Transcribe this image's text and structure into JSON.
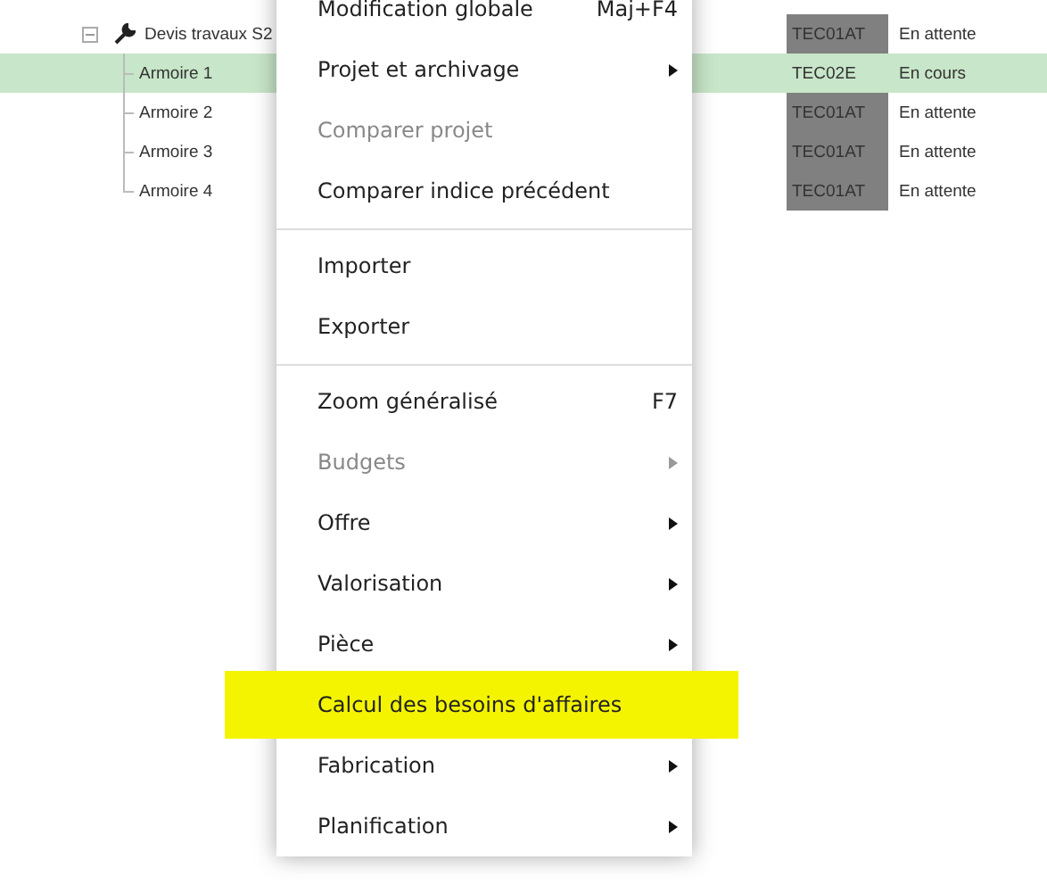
{
  "tree": [
    {
      "label": "Devis travaux S2",
      "expanded": true,
      "selected": false,
      "code": "TEC01AT",
      "status": "En attente",
      "children": [
        {
          "label": "Armoire 1",
          "selected": true,
          "code": "TEC02E",
          "status": "En cours"
        },
        {
          "label": "Armoire 2",
          "selected": false,
          "code": "TEC01AT",
          "status": "En attente"
        },
        {
          "label": "Armoire 3",
          "selected": false,
          "code": "TEC01AT",
          "status": "En attente"
        },
        {
          "label": "Armoire 4",
          "selected": false,
          "code": "TEC01AT",
          "status": "En attente"
        }
      ]
    }
  ],
  "context_menu": [
    {
      "kind": "item",
      "label": "Modification globale",
      "shortcut": "Maj+F4",
      "disabled": false,
      "submenu": false,
      "highlighted": false
    },
    {
      "kind": "item",
      "label": "Projet et archivage",
      "disabled": false,
      "submenu": true,
      "highlighted": false
    },
    {
      "kind": "item",
      "label": "Comparer projet",
      "disabled": true,
      "submenu": false,
      "highlighted": false
    },
    {
      "kind": "item",
      "label": "Comparer indice précédent",
      "disabled": false,
      "submenu": false,
      "highlighted": false
    },
    {
      "kind": "divider"
    },
    {
      "kind": "item",
      "label": "Importer",
      "disabled": false,
      "submenu": false,
      "highlighted": false
    },
    {
      "kind": "item",
      "label": "Exporter",
      "disabled": false,
      "submenu": false,
      "highlighted": false
    },
    {
      "kind": "divider"
    },
    {
      "kind": "item",
      "label": "Zoom généralisé",
      "shortcut": "F7",
      "disabled": false,
      "submenu": false,
      "highlighted": false
    },
    {
      "kind": "item",
      "label": "Budgets",
      "disabled": true,
      "submenu": true,
      "highlighted": false
    },
    {
      "kind": "item",
      "label": "Offre",
      "disabled": false,
      "submenu": true,
      "highlighted": false
    },
    {
      "kind": "item",
      "label": "Valorisation",
      "disabled": false,
      "submenu": true,
      "highlighted": false
    },
    {
      "kind": "item",
      "label": "Pièce",
      "disabled": false,
      "submenu": true,
      "highlighted": false
    },
    {
      "kind": "item",
      "label": "Calcul des besoins d'affaires",
      "disabled": false,
      "submenu": false,
      "highlighted": true
    },
    {
      "kind": "item",
      "label": "Fabrication",
      "disabled": false,
      "submenu": true,
      "highlighted": false
    },
    {
      "kind": "item",
      "label": "Planification",
      "disabled": false,
      "submenu": true,
      "highlighted": false
    }
  ]
}
